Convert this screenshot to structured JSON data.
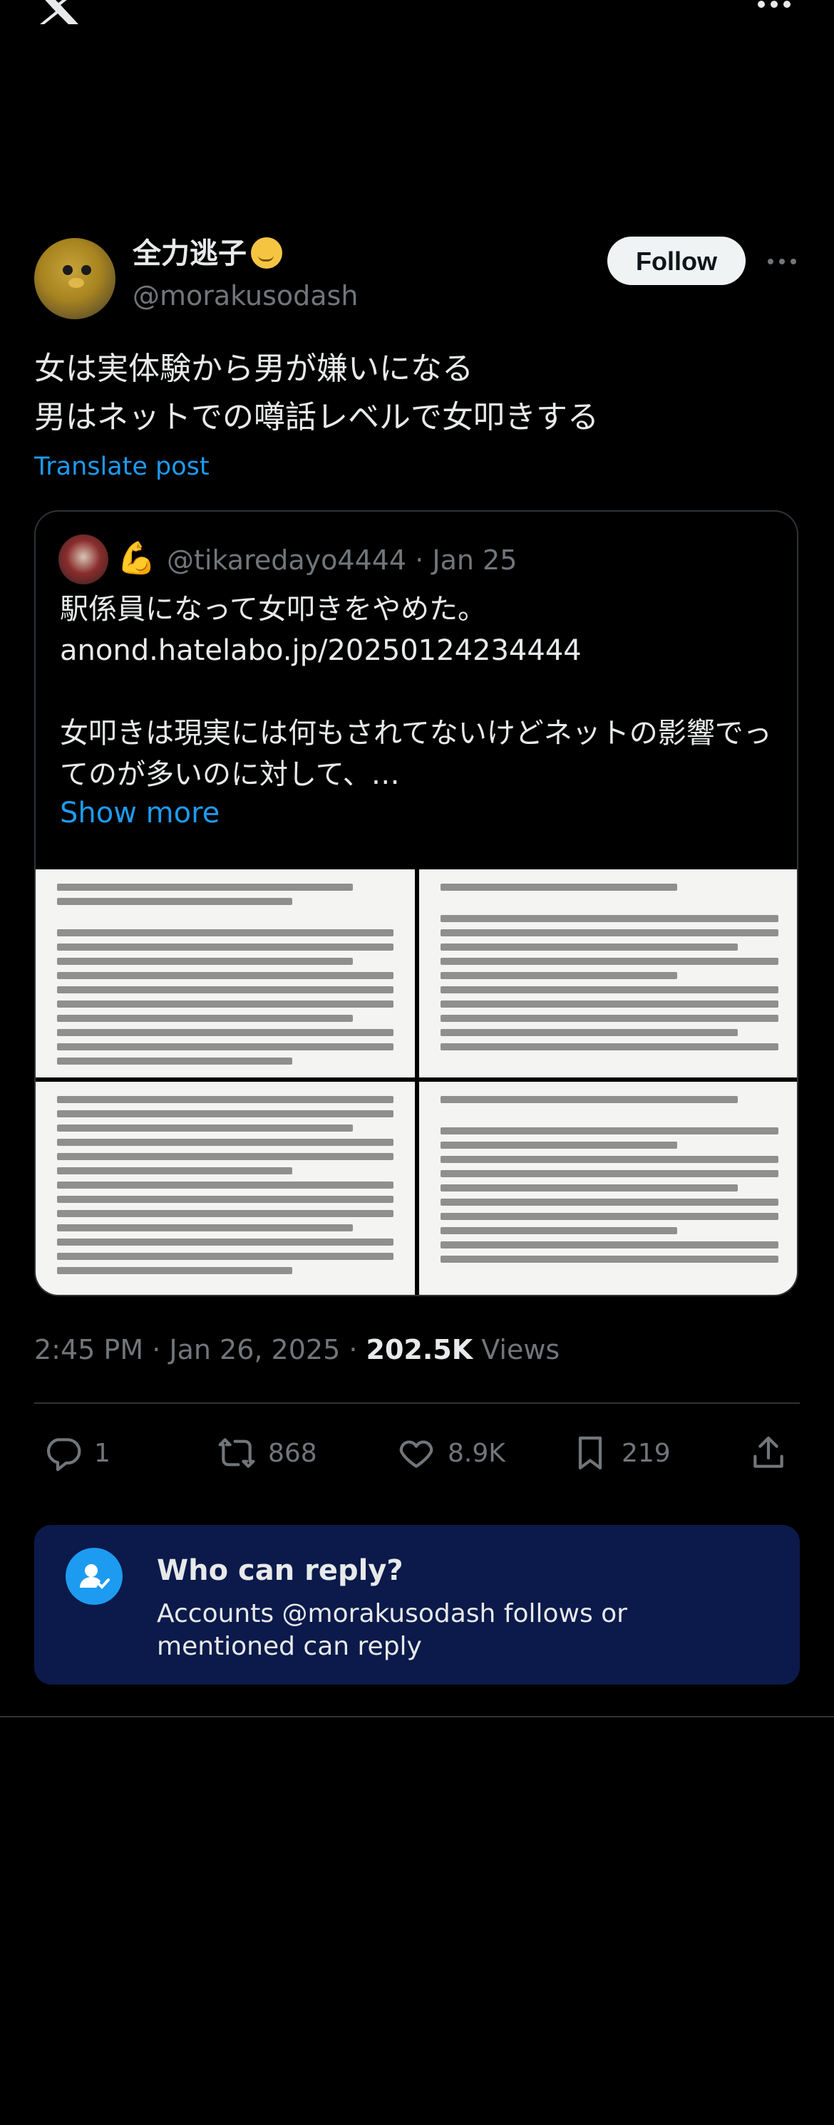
{
  "nav": {
    "logo_icon": "x-logo-icon",
    "more_icon": "more-horizontal-icon"
  },
  "author": {
    "display_name": "全力逃子",
    "emoji_icon": "melting-face-emoji-icon",
    "handle": "@morakusodash",
    "follow_label": "Follow"
  },
  "post": {
    "text": "女は実体験から男が嫌いになる\n男はネットでの噂話レベルで女叩きする",
    "translate_label": "Translate post"
  },
  "quote": {
    "emoji": "💪",
    "handle": "@tikaredayo4444",
    "separator": " · ",
    "date": "Jan 25",
    "text": "駅係員になって女叩きをやめた。\nanond.hatelabo.jp/20250124234444\n\n女叩きは現実には何もされてないけどネットの影響でってのが多いのに対して、…",
    "show_more": "Show more",
    "images": [
      "article-screenshot-1",
      "article-screenshot-2",
      "article-screenshot-3",
      "article-screenshot-4"
    ]
  },
  "meta": {
    "time": "2:45 PM",
    "date": "Jan 26, 2025",
    "views_count": "202.5K",
    "views_label": "Views",
    "sep": " · "
  },
  "actions": {
    "replies": "1",
    "reposts": "868",
    "likes": "8.9K",
    "bookmarks": "219"
  },
  "reply_restriction": {
    "title": "Who can reply?",
    "description": "Accounts @morakusodash follows or mentioned can reply"
  },
  "colors": {
    "accent": "#1d9bf0",
    "muted": "#71767b",
    "reply_box_bg": "#0b1a4a"
  }
}
